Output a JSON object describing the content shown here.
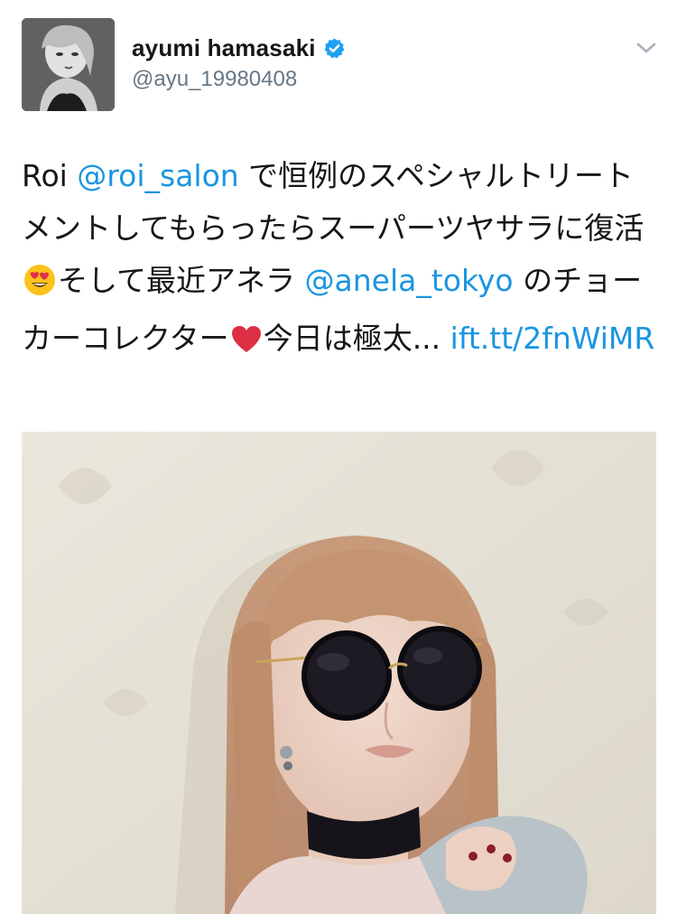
{
  "tweet": {
    "author": {
      "display_name": "ayumi hamasaki",
      "handle": "@ayu_19980408",
      "verified": true,
      "avatar_icon": "profile-photo"
    },
    "text": {
      "part1": "Roi ",
      "mention1": "@roi_salon",
      "part2": " で恒例のスペシャルトリートメントしてもらったらスーパーツヤサラに復活",
      "emoji1": "heart-eyes-emoji",
      "part3": "そして最近アネラ ",
      "mention2": "@anela_tokyo",
      "part4": " のチョーカーコレクター",
      "emoji2": "red-heart-emoji",
      "part5": "今日は極太... ",
      "link": "ift.tt/2fnWiMR"
    },
    "media": {
      "type": "photo",
      "subject": "woman-with-round-sunglasses-and-velvet-choker"
    }
  },
  "colors": {
    "link": "#1b95e0",
    "verified_badge": "#1da1f2",
    "text": "#14171a",
    "secondary_text": "#657786"
  },
  "icons": {
    "menu": "chevron-down-icon",
    "verified": "verified-badge-icon"
  }
}
